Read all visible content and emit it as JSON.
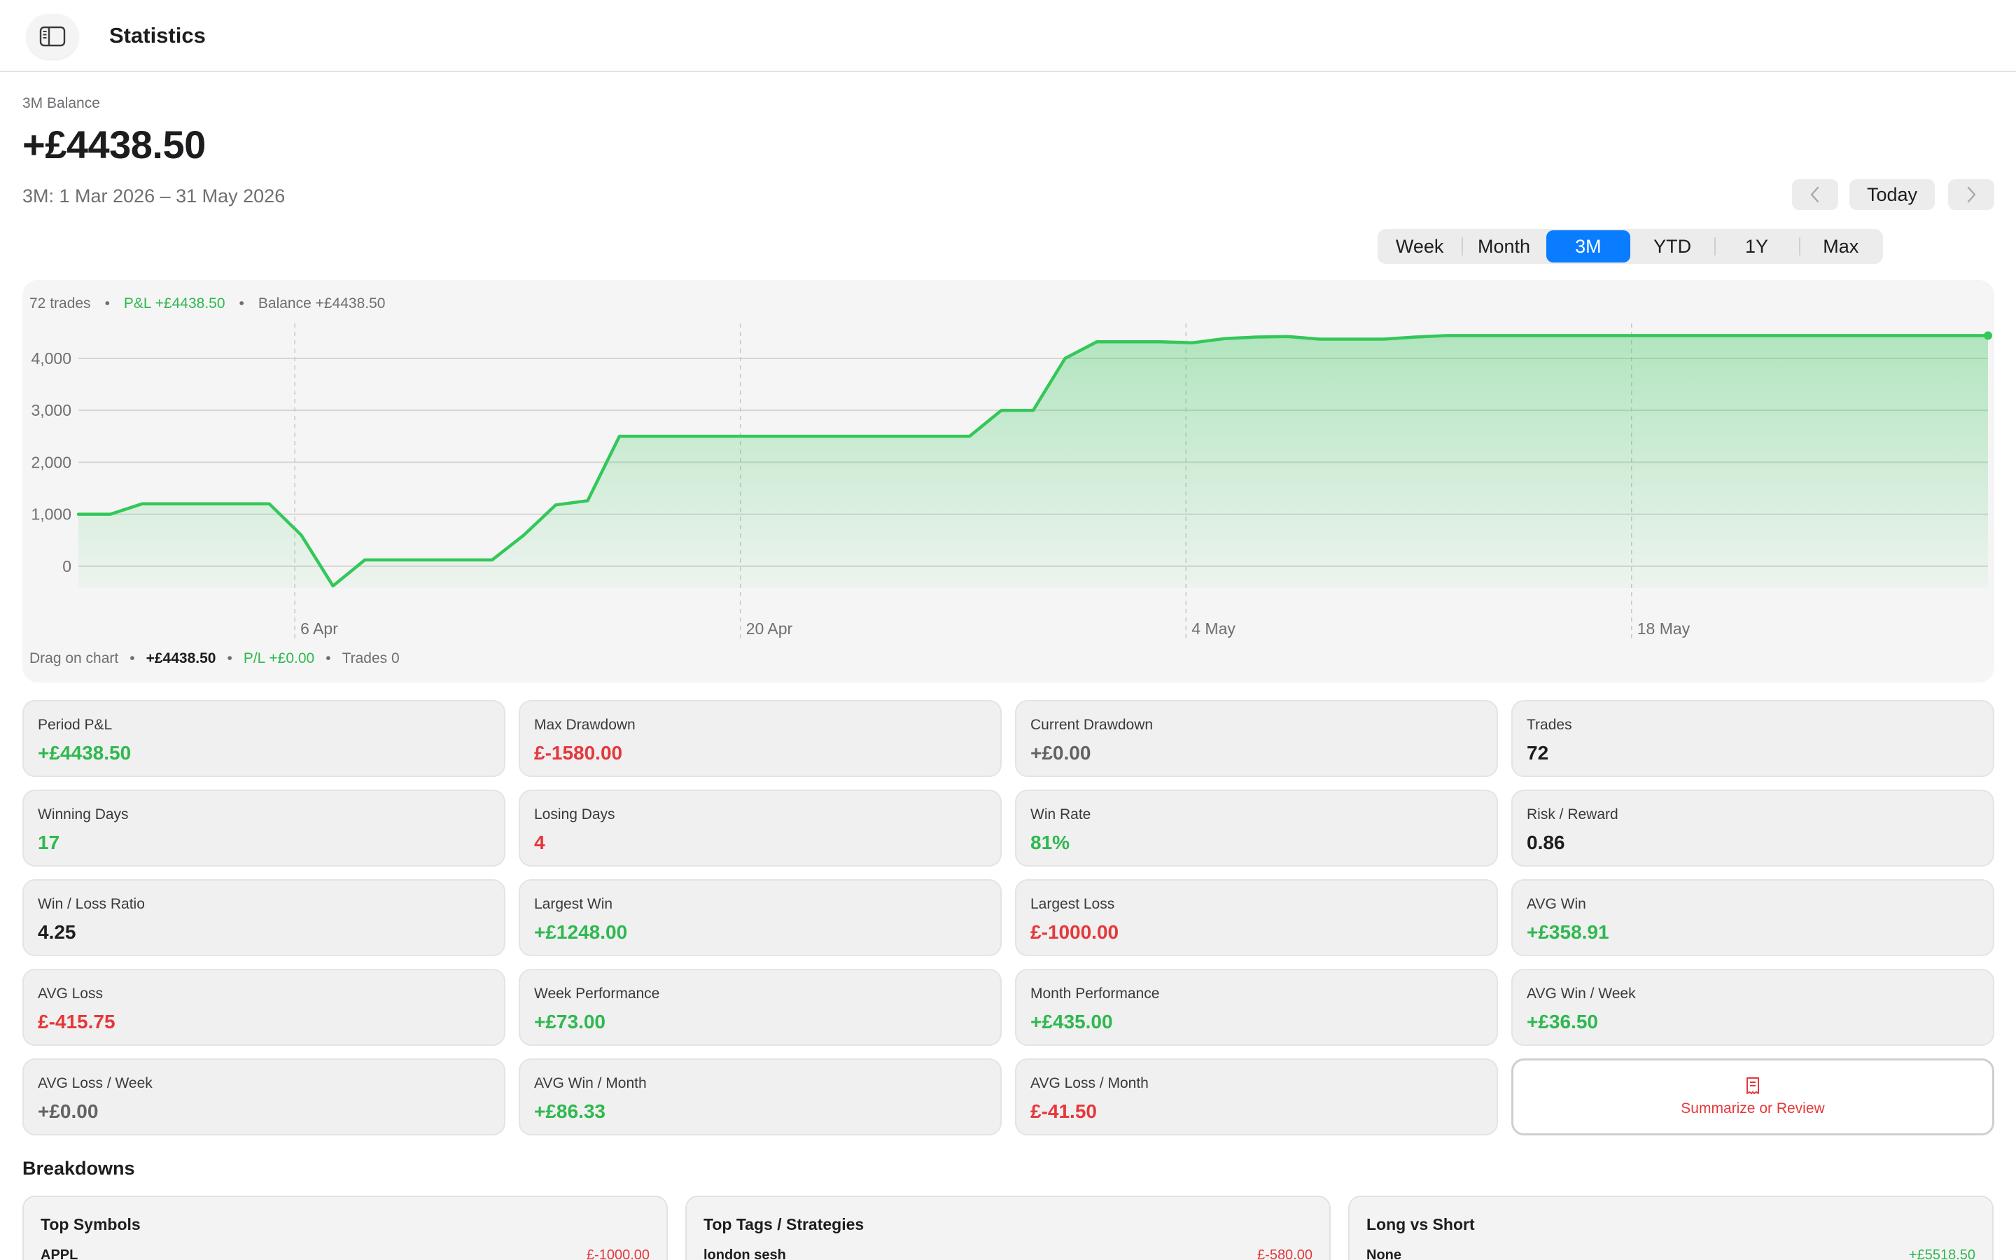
{
  "toolbar": {
    "title": "Statistics"
  },
  "header": {
    "balance_caption": "3M Balance",
    "balance_value": "+£4438.50",
    "period_range": "3M: 1 Mar 2026 – 31 May 2026",
    "today_label": "Today",
    "ranges": [
      "Week",
      "Month",
      "3M",
      "YTD",
      "1Y",
      "Max"
    ],
    "active_range": "3M"
  },
  "chart_summary": {
    "trades": "72 trades",
    "pnl": "P&L +£4438.50",
    "balance": "Balance +£4438.50"
  },
  "chart_footer": {
    "hint": "Drag on chart",
    "value": "+£4438.50",
    "pl": "P/L +£0.00",
    "trades": "Trades 0"
  },
  "chart_data": {
    "type": "area",
    "ylabel": "",
    "xlabel": "",
    "ylim": [
      -420,
      4700
    ],
    "yticks": [
      0,
      1000,
      2000,
      3000,
      4000
    ],
    "ytick_labels": [
      "0",
      "1,000",
      "2,000",
      "3,000",
      "4,000"
    ],
    "xticks": [
      {
        "day": 36,
        "label": "6 Apr"
      },
      {
        "day": 50,
        "label": "20 Apr"
      },
      {
        "day": 64,
        "label": "4 May"
      },
      {
        "day": 78,
        "label": "18 May"
      }
    ],
    "x_domain": [
      29.2,
      89.2
    ],
    "line_color": "#34c759",
    "points": [
      [
        29.2,
        1000
      ],
      [
        30.2,
        1000
      ],
      [
        31.2,
        1200
      ],
      [
        32.2,
        1200
      ],
      [
        33.2,
        1200
      ],
      [
        34.2,
        1200
      ],
      [
        35.2,
        1200
      ],
      [
        36.2,
        600
      ],
      [
        37.2,
        -380
      ],
      [
        38.2,
        120
      ],
      [
        39.2,
        120
      ],
      [
        40.2,
        120
      ],
      [
        41.2,
        120
      ],
      [
        42.2,
        120
      ],
      [
        43.2,
        600
      ],
      [
        44.2,
        1180
      ],
      [
        45.2,
        1260
      ],
      [
        46.2,
        2500
      ],
      [
        47.2,
        2500
      ],
      [
        48.2,
        2500
      ],
      [
        49.2,
        2500
      ],
      [
        50.2,
        2500
      ],
      [
        51.2,
        2500
      ],
      [
        52.2,
        2500
      ],
      [
        53.2,
        2500
      ],
      [
        54.2,
        2500
      ],
      [
        55.2,
        2500
      ],
      [
        56.2,
        2500
      ],
      [
        57.2,
        2500
      ],
      [
        58.2,
        3000
      ],
      [
        59.2,
        3000
      ],
      [
        60.2,
        4000
      ],
      [
        61.2,
        4320
      ],
      [
        62.2,
        4320
      ],
      [
        63.2,
        4320
      ],
      [
        64.2,
        4300
      ],
      [
        65.2,
        4380
      ],
      [
        66.2,
        4410
      ],
      [
        67.2,
        4420
      ],
      [
        68.2,
        4370
      ],
      [
        69.2,
        4370
      ],
      [
        70.2,
        4370
      ],
      [
        71.2,
        4410
      ],
      [
        72.2,
        4438.5
      ],
      [
        73.2,
        4438.5
      ],
      [
        74.2,
        4438.5
      ],
      [
        75.2,
        4438.5
      ],
      [
        76.2,
        4438.5
      ],
      [
        77.2,
        4438.5
      ],
      [
        78.2,
        4438.5
      ],
      [
        79.2,
        4438.5
      ],
      [
        80.2,
        4438.5
      ],
      [
        81.2,
        4438.5
      ],
      [
        82.2,
        4438.5
      ],
      [
        83.2,
        4438.5
      ],
      [
        84.2,
        4438.5
      ],
      [
        85.2,
        4438.5
      ],
      [
        86.2,
        4438.5
      ],
      [
        87.2,
        4438.5
      ],
      [
        88.2,
        4438.5
      ],
      [
        89.2,
        4438.5
      ]
    ]
  },
  "stats": [
    {
      "label": "Period P&L",
      "value": "+£4438.50",
      "tone": "green"
    },
    {
      "label": "Max Drawdown",
      "value": "£-1580.00",
      "tone": "red"
    },
    {
      "label": "Current Drawdown",
      "value": "+£0.00",
      "tone": "gray"
    },
    {
      "label": "Trades",
      "value": "72",
      "tone": "black"
    },
    {
      "label": "Winning Days",
      "value": "17",
      "tone": "green"
    },
    {
      "label": "Losing Days",
      "value": "4",
      "tone": "red"
    },
    {
      "label": "Win Rate",
      "value": "81%",
      "tone": "green"
    },
    {
      "label": "Risk / Reward",
      "value": "0.86",
      "tone": "black"
    },
    {
      "label": "Win / Loss Ratio",
      "value": "4.25",
      "tone": "black"
    },
    {
      "label": "Largest Win",
      "value": "+£1248.00",
      "tone": "green"
    },
    {
      "label": "Largest Loss",
      "value": "£-1000.00",
      "tone": "red"
    },
    {
      "label": "AVG Win",
      "value": "+£358.91",
      "tone": "green"
    },
    {
      "label": "AVG Loss",
      "value": "£-415.75",
      "tone": "red"
    },
    {
      "label": "Week Performance",
      "value": "+£73.00",
      "tone": "green"
    },
    {
      "label": "Month Performance",
      "value": "+£435.00",
      "tone": "green"
    },
    {
      "label": "AVG Win / Week",
      "value": "+£36.50",
      "tone": "green"
    },
    {
      "label": "AVG Loss / Week",
      "value": "+£0.00",
      "tone": "gray"
    },
    {
      "label": "AVG Win / Month",
      "value": "+£86.33",
      "tone": "green"
    },
    {
      "label": "AVG Loss / Month",
      "value": "£-41.50",
      "tone": "red"
    }
  ],
  "action_card": {
    "label": "Summarize or Review",
    "icon": "receipt-icon"
  },
  "breakdowns": {
    "title": "Breakdowns",
    "panels": [
      {
        "title": "Top Symbols",
        "row_name": "APPL",
        "row_value": "£-1000.00",
        "tone": "red"
      },
      {
        "title": "Top Tags / Strategies",
        "row_name": "london sesh",
        "row_value": "£-580.00",
        "tone": "red"
      },
      {
        "title": "Long vs Short",
        "row_name": "None",
        "row_value": "+£5518.50",
        "tone": "green"
      }
    ]
  }
}
